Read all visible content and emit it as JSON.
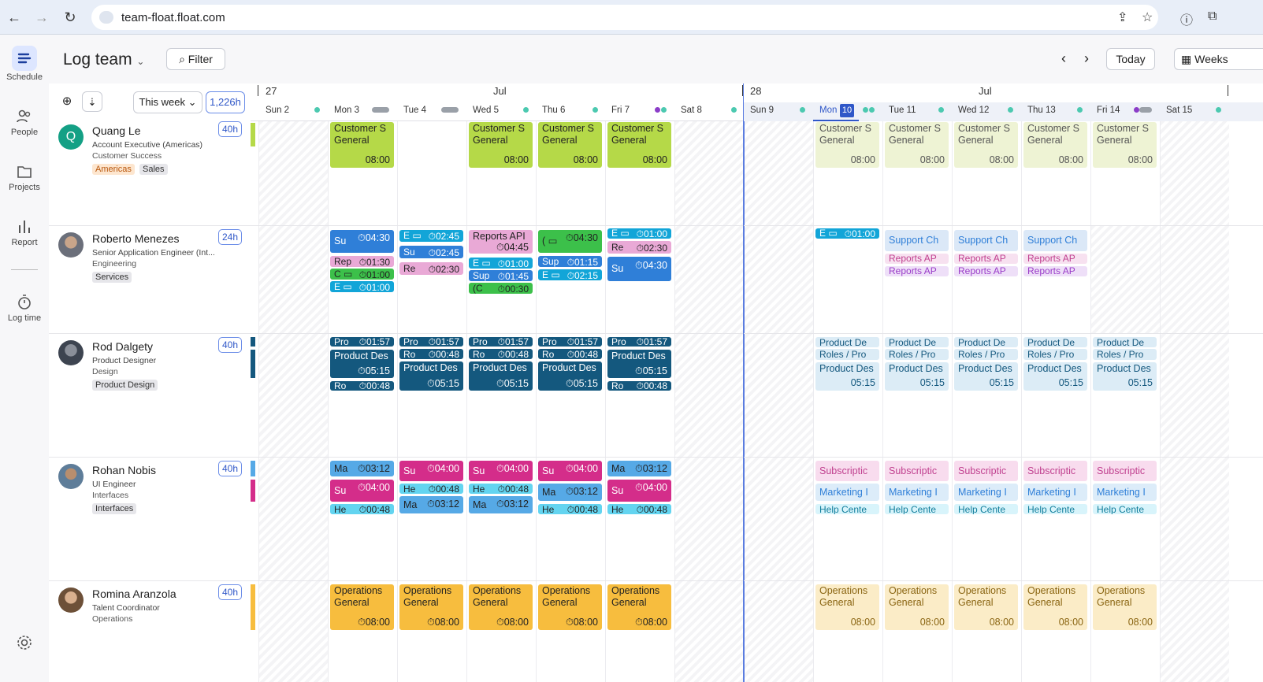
{
  "browser": {
    "url": "team-float.float.com"
  },
  "sidebar": {
    "items": [
      {
        "label": "Schedule"
      },
      {
        "label": "People"
      },
      {
        "label": "Projects"
      },
      {
        "label": "Report"
      },
      {
        "label": "Log time"
      }
    ]
  },
  "toolbar": {
    "title": "Log team",
    "filter": "Filter",
    "today": "Today",
    "view": "Weeks"
  },
  "people_header": {
    "range": "This week",
    "hours": "1,226h"
  },
  "weeks": [
    {
      "num": "27",
      "month": "Jul"
    },
    {
      "num": "28",
      "month": "Jul"
    }
  ],
  "days": [
    "Sun 2",
    "Mon 3",
    "Tue 4",
    "Wed 5",
    "Thu 6",
    "Fri 7",
    "Sat 8",
    "Sun 9",
    "Mon",
    "Tue 11",
    "Wed 12",
    "Thu 13",
    "Fri 14",
    "Sat 15"
  ],
  "today_num": "10",
  "colors": {
    "green": "#b5d948",
    "green_light": "#eef3d4",
    "blue": "#2f7fd8",
    "pink": "#e9a9d6",
    "teal": "#12a5d8",
    "dgreen": "#3cc04a",
    "navy": "#14587e",
    "magenta": "#d42d8a",
    "cyan": "#63d4f0",
    "ltblue": "#56a9e6",
    "orange": "#f7bd3e",
    "orange_light": "#fbecc7",
    "accent": "#2f57c8"
  },
  "people": [
    {
      "name": "Quang Le",
      "role": "Account Executive (Americas)",
      "dept": "Customer Success",
      "tags": [
        "Americas",
        "Sales"
      ],
      "hours": "40h",
      "initial": "Q"
    },
    {
      "name": "Roberto Menezes",
      "role": "Senior Application Engineer (Int...",
      "dept": "Engineering",
      "tags": [
        "Services"
      ],
      "hours": "24h"
    },
    {
      "name": "Rod Dalgety",
      "role": "Product Designer",
      "dept": "Design",
      "tags": [
        "Product Design"
      ],
      "hours": "40h"
    },
    {
      "name": "Rohan Nobis",
      "role": "UI Engineer",
      "dept": "Interfaces",
      "tags": [
        "Interfaces"
      ],
      "hours": "40h"
    },
    {
      "name": "Romina Aranzola",
      "role": "Talent Coordinator",
      "dept": "Operations",
      "tags": [],
      "hours": "40h"
    }
  ],
  "cards": {
    "cs": "Customer S",
    "general": "General",
    "t0800": "08:00",
    "ops": "Operations",
    "su": "Su",
    "t0430": "04:30",
    "rep": "Rep",
    "t0130": "01:30",
    "c": "C",
    "t0100": "01:00",
    "e": "E",
    "t0245": "02:45",
    "re": "Re",
    "t0230": "02:30",
    "reportsapi": "Reports API",
    "t0445": "04:45",
    "sup": "Sup",
    "t0145": "01:45",
    "t0030": "00:30",
    "t0115": "01:15",
    "t0215": "02:15",
    "supportch": "Support Ch",
    "reportsap": "Reports AP",
    "pro": "Pro",
    "t0157": "01:57",
    "productdes": "Product Des",
    "t0515": "05:15",
    "ro": "Ro",
    "t0048": "00:48",
    "productde": "Product De",
    "rolespro": "Roles / Pro",
    "ma": "Ma",
    "t0312": "03:12",
    "t0400": "04:00",
    "he": "He",
    "subscriptio": "Subscriptic",
    "marketing": "Marketing I",
    "helpcenter": "Help Cente"
  }
}
